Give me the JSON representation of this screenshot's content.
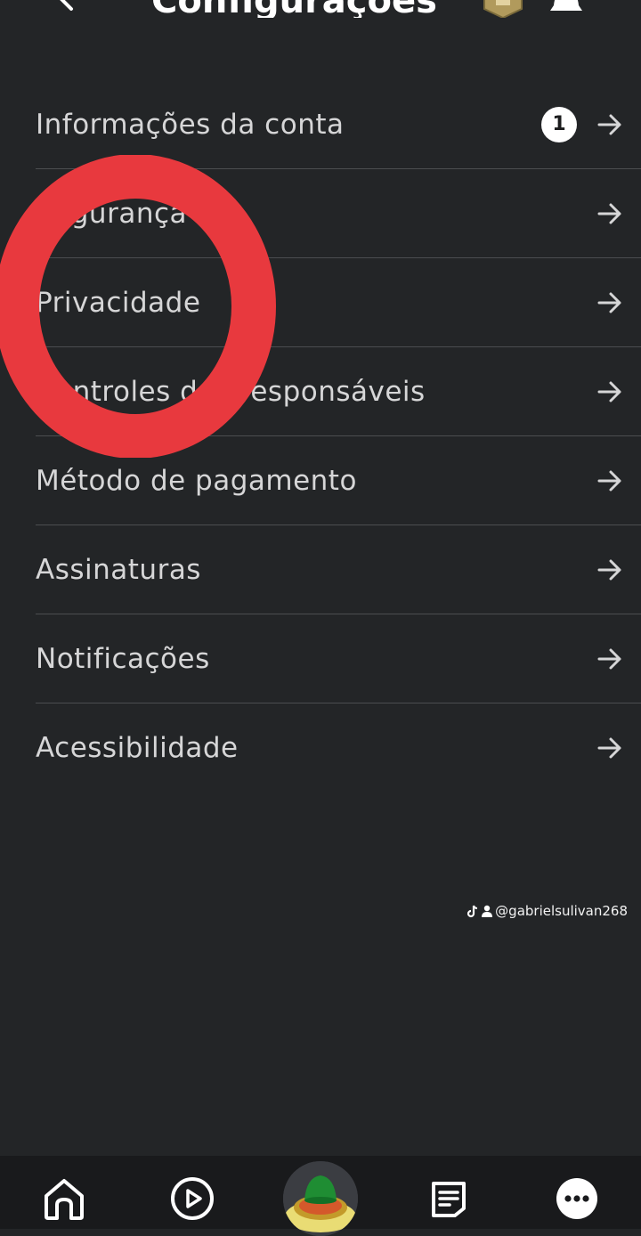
{
  "header": {
    "title": "Configurações",
    "back_icon": "chevron-left-icon",
    "robux_icon": "robux-icon",
    "bell_icon": "bell-icon"
  },
  "menu": {
    "items": [
      {
        "label": "Informações da conta",
        "badge": "1"
      },
      {
        "label": "Segurança"
      },
      {
        "label": "Privacidade"
      },
      {
        "label": "Controles dos responsáveis"
      },
      {
        "label": "Método de pagamento"
      },
      {
        "label": "Assinaturas"
      },
      {
        "label": "Notificações"
      },
      {
        "label": "Acessibilidade"
      }
    ],
    "arrow_icon": "arrow-right-icon"
  },
  "annotation": {
    "color": "#e8393e"
  },
  "watermark": {
    "text": "@gabrielsulivan268"
  },
  "bottom_nav": {
    "items": [
      "home-icon",
      "play-icon",
      "avatar",
      "chat-icon",
      "more-icon"
    ]
  },
  "colors": {
    "background": "#232527",
    "divider": "#4b4d50",
    "text": "#d6d6d7",
    "nav_background": "#191a1c"
  }
}
